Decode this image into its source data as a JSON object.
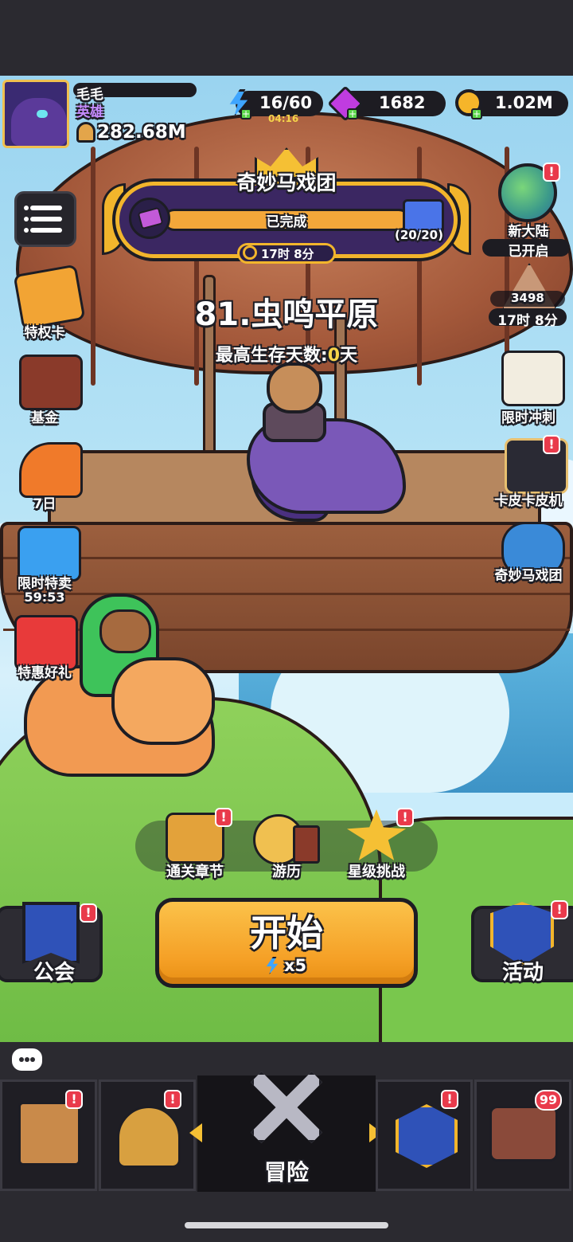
{
  "player": {
    "name": "毛毛",
    "rank": "英雄",
    "power": "282.68M"
  },
  "resources": {
    "energy": "16/60",
    "energy_timer": "04:16",
    "gems": "1682",
    "gold": "1.02M"
  },
  "event_banner": {
    "title": "奇妙马戏团",
    "status": "已完成",
    "progress": "(20/20)",
    "timer": "17时 8分",
    "progress_fraction": 1.0
  },
  "stage": {
    "title": "81.虫鸣平原",
    "survival_label": "最高生存天数:",
    "survival_days": "0",
    "survival_unit": "天"
  },
  "left_icons": [
    {
      "label": "特权卡"
    },
    {
      "label": "基金"
    },
    {
      "label": "7日"
    },
    {
      "label": "限时特卖",
      "timer": "59:53"
    },
    {
      "label": "特惠好礼"
    }
  ],
  "right_icons": {
    "new_land": {
      "label": "新大陆",
      "status": "已开启"
    },
    "pyramid": {
      "count": "3498",
      "timer": "17时 8分"
    },
    "rush": {
      "label": "限时冲刺"
    },
    "skin_machine": {
      "label": "卡皮卡皮机"
    },
    "circus": {
      "label": "奇妙马戏团"
    }
  },
  "mid_row": {
    "chapter": "通关章节",
    "travel": "游历",
    "star": "星级挑战"
  },
  "start_button": {
    "label": "开始",
    "cost": "x5"
  },
  "guild": {
    "label": "公会"
  },
  "activity": {
    "label": "活动"
  },
  "bottom_nav": {
    "adventure": "冒险",
    "chest_count": "99"
  },
  "badge_symbol": "!",
  "colors": {
    "accent_gold": "#f2b52c",
    "start_orange": "#f5a026",
    "badge_red": "#e93a4b",
    "rank_purple": "#c68cff"
  }
}
